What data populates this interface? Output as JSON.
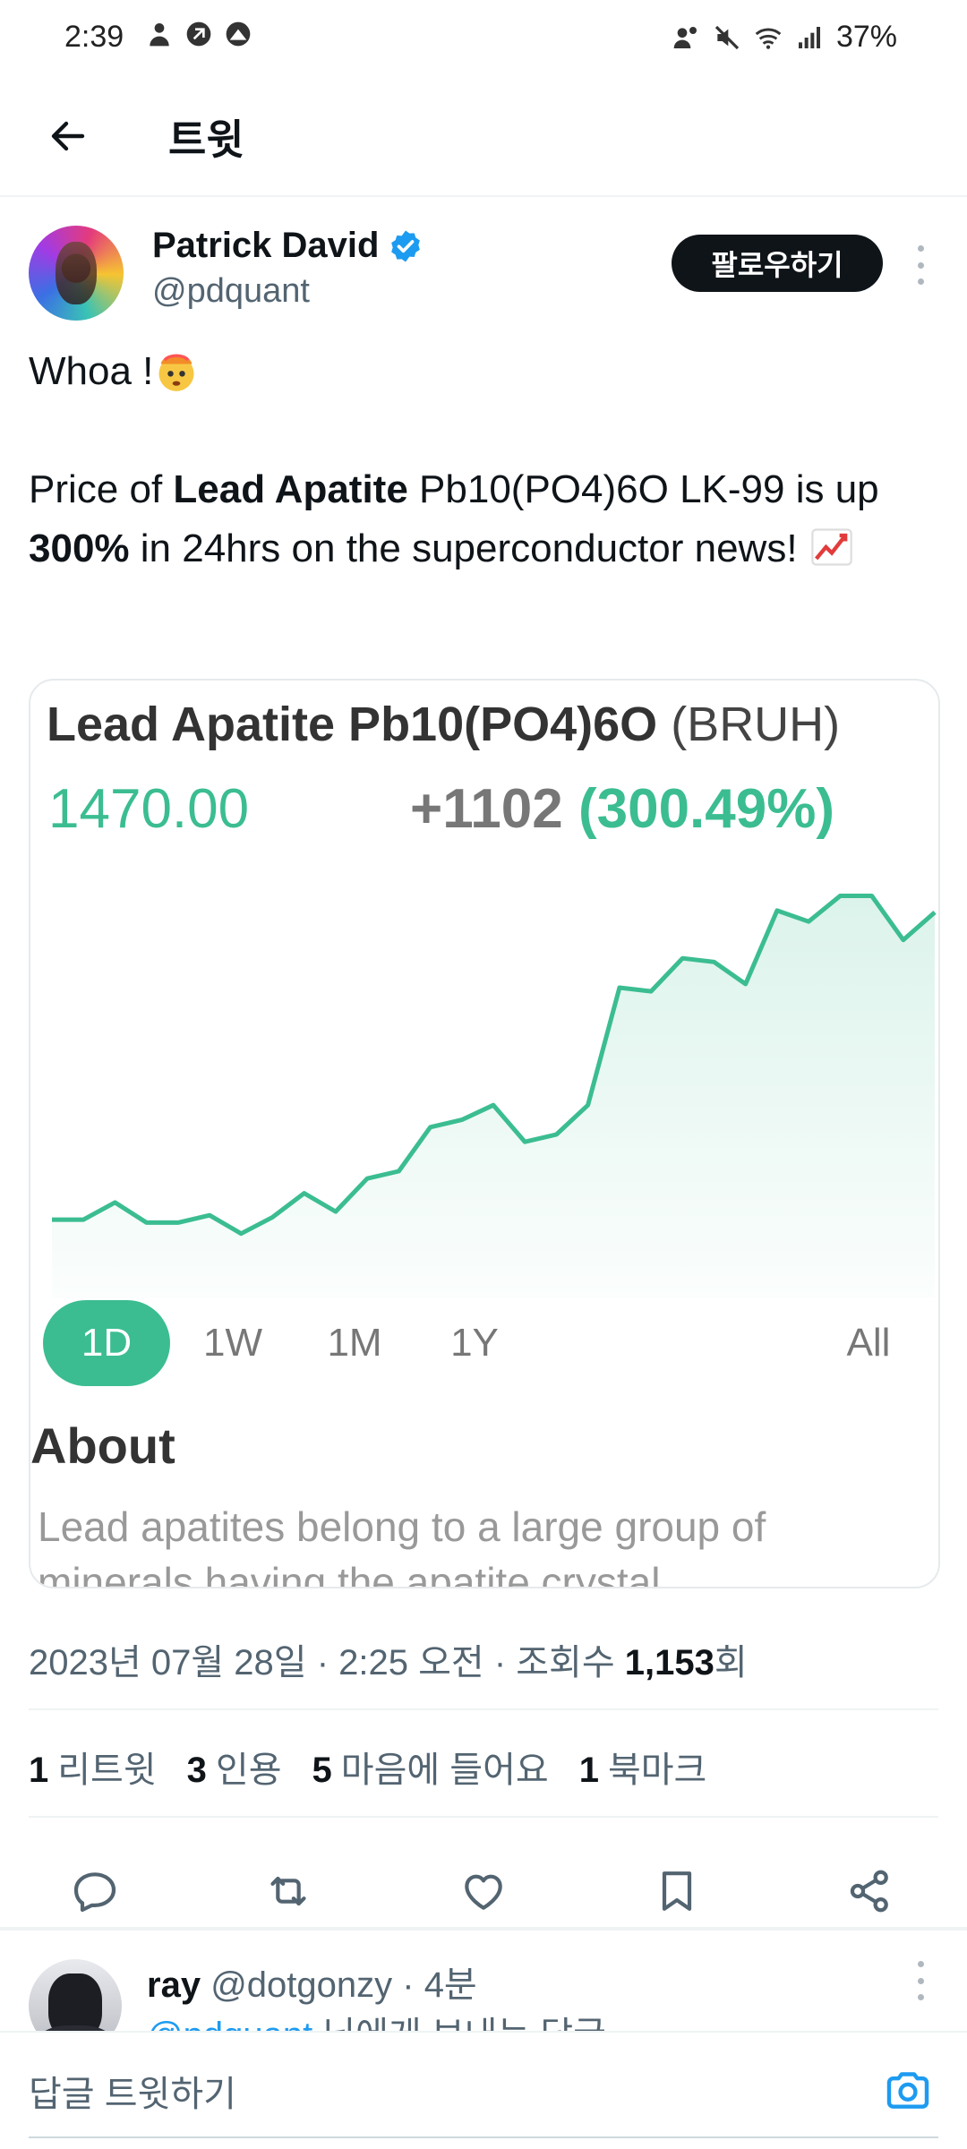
{
  "status_bar": {
    "time": "2:39",
    "battery": "37%"
  },
  "header": {
    "title": "트윗"
  },
  "tweet": {
    "author_name": "Patrick David",
    "author_handle": "@pdquant",
    "follow_label": "팔로우하기",
    "line1": "Whoa !",
    "body_part1": "Price of ",
    "body_bold1": "Lead Apatite",
    "body_part2": " Pb10(PO4)6O LK-99 is up ",
    "body_bold2": "300%",
    "body_part3": " in 24hrs on the superconductor news! ",
    "meta_prefix": "2023년 07월 28일 · 2:25 오전 · 조회수 ",
    "meta_views": "1,153",
    "meta_suffix": "회",
    "stats": [
      {
        "count": "1",
        "label": "리트윗"
      },
      {
        "count": "3",
        "label": "인용"
      },
      {
        "count": "5",
        "label": "마음에 들어요"
      },
      {
        "count": "1",
        "label": "북마크"
      }
    ]
  },
  "card": {
    "title": "Lead Apatite Pb10(PO4)6O",
    "ticker": "(BRUH)",
    "price": "1470.00",
    "change": "+1102",
    "change_pct": "(300.49%)",
    "ranges": [
      "1D",
      "1W",
      "1M",
      "1Y",
      "All"
    ],
    "active_range": "1D",
    "about_title": "About",
    "about_text": "Lead apatites belong to a large group of minerals having the apatite crystal"
  },
  "chart_data": {
    "type": "area",
    "title": "",
    "xlabel": "",
    "ylabel": "",
    "color": "#3bbd91",
    "values": [
      368,
      368,
      415,
      360,
      360,
      380,
      330,
      375,
      440,
      390,
      480,
      500,
      620,
      640,
      680,
      580,
      600,
      680,
      1000,
      990,
      1080,
      1070,
      1010,
      1210,
      1180,
      1250,
      1250,
      1130,
      1205
    ],
    "ylim": [
      300,
      1300
    ]
  },
  "reply": {
    "name": "ray",
    "handle": "@dotgonzy",
    "time": " · 4분",
    "mention": "@pdquant",
    "line_suffix": " 님에게 보내는 답글"
  },
  "composer": {
    "placeholder": "답글 트윗하기"
  },
  "colors": {
    "accent": "#3bbd91",
    "link": "#1d9bf0",
    "text": "#0f1419",
    "muted": "#536471"
  }
}
